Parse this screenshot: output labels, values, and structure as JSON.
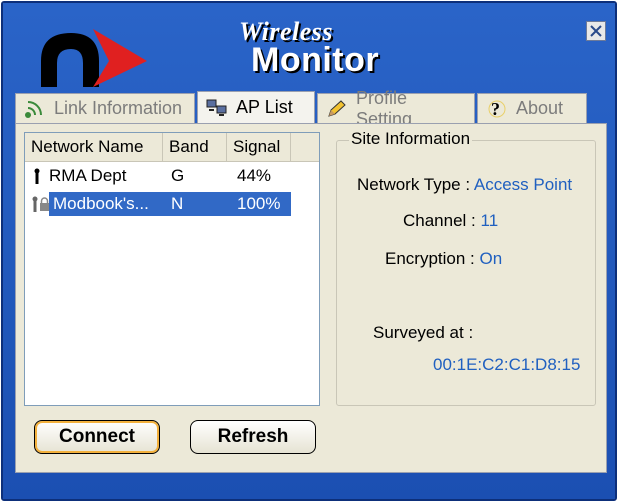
{
  "app": {
    "title_script": "Wireless",
    "title_main": "Monitor"
  },
  "tabs": [
    {
      "label": "Link Information",
      "icon": "signal-icon"
    },
    {
      "label": "AP List",
      "icon": "network-computers-icon",
      "active": true
    },
    {
      "label": "Profile Setting",
      "icon": "pencil-icon"
    },
    {
      "label": "About",
      "icon": "question-icon"
    }
  ],
  "ap_list": {
    "columns": [
      "Network Name",
      "Band",
      "Signal"
    ],
    "rows": [
      {
        "name": "RMA Dept",
        "band": "G",
        "signal": "44%",
        "icon": "antenna-icon",
        "selected": false
      },
      {
        "name": "Modbook's...",
        "band": "N",
        "signal": "100%",
        "icon": "locked-antenna-icon",
        "selected": true
      }
    ]
  },
  "site_info": {
    "legend": "Site Information",
    "network_type_label": "Network Type :",
    "network_type_value": "Access Point",
    "channel_label": "Channel :",
    "channel_value": "11",
    "encryption_label": "Encryption :",
    "encryption_value": "On",
    "surveyed_label": "Surveyed at :",
    "surveyed_value": "00:1E:C2:C1:D8:15"
  },
  "buttons": {
    "connect": "Connect",
    "refresh": "Refresh"
  },
  "colors": {
    "window_blue": "#1f55b8",
    "selection": "#3169c6",
    "value_text": "#2060c0",
    "logo_red": "#e02020"
  }
}
